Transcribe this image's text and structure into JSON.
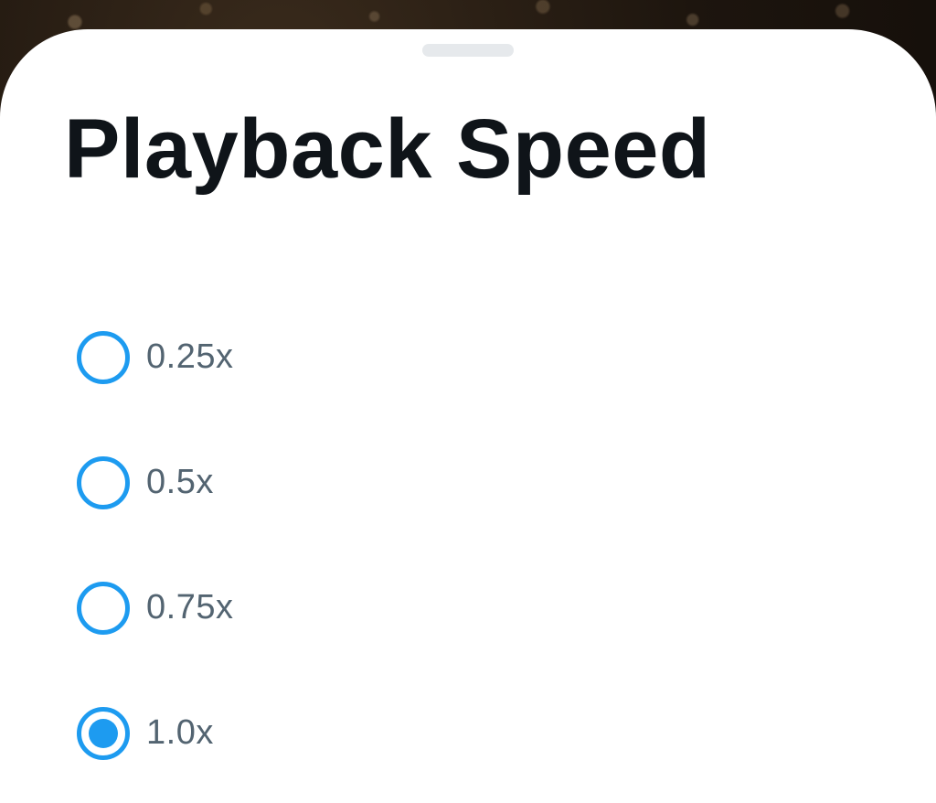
{
  "sheet": {
    "title": "Playback Speed",
    "accent_color": "#1d9bf0",
    "options": [
      {
        "label": "0.25x",
        "selected": false
      },
      {
        "label": "0.5x",
        "selected": false
      },
      {
        "label": "0.75x",
        "selected": false
      },
      {
        "label": "1.0x",
        "selected": true
      }
    ],
    "selected_value": "1.0x"
  }
}
